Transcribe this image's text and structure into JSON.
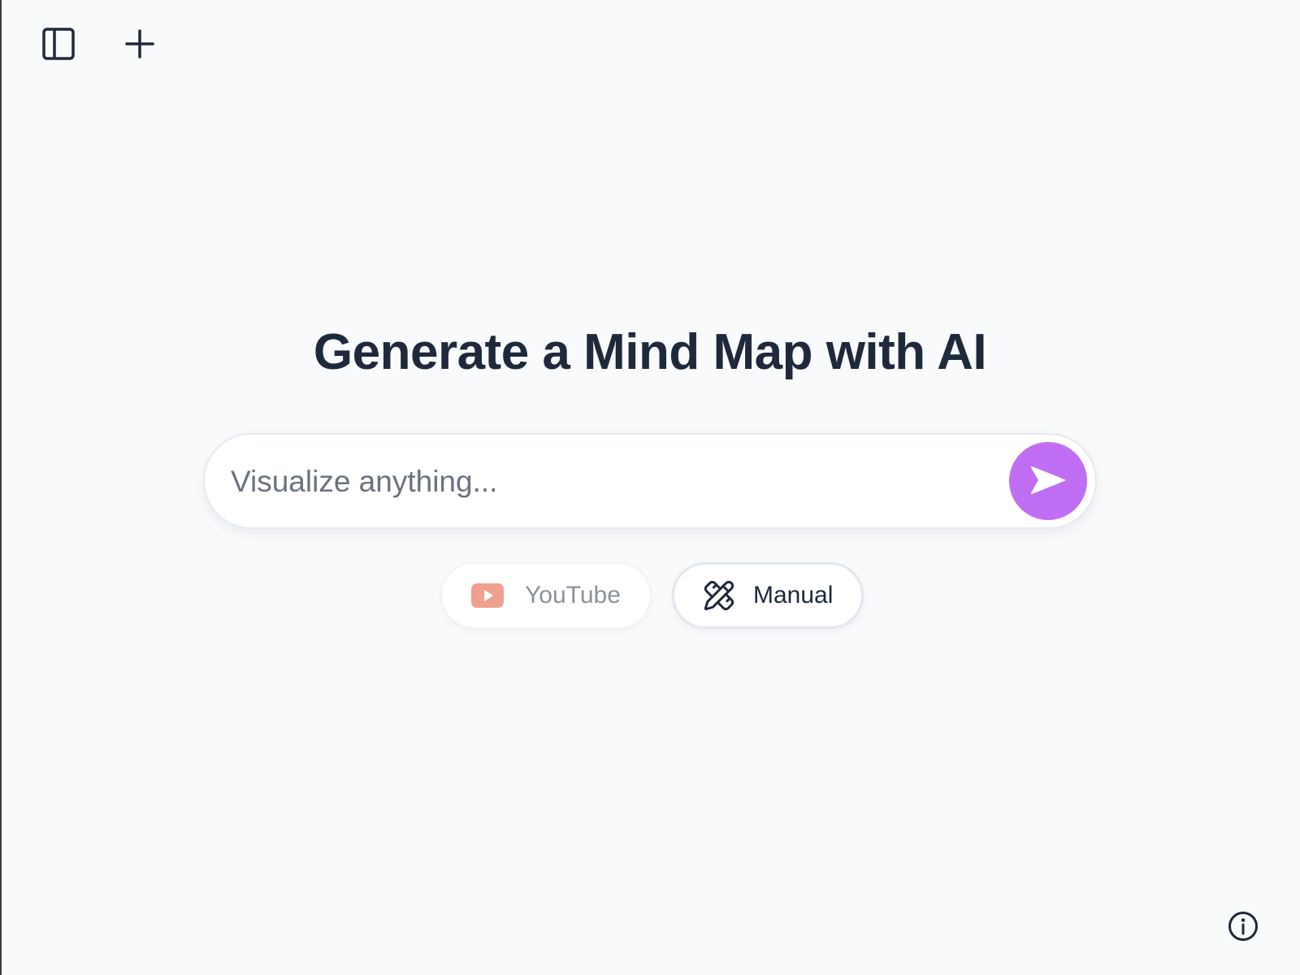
{
  "header": {
    "sidebar_toggle_icon": "sidebar-panel-icon",
    "new_icon": "plus-icon"
  },
  "main": {
    "title": "Generate a Mind Map with AI",
    "prompt": {
      "placeholder": "Visualize anything...",
      "value": "",
      "send_icon": "send-arrow-icon",
      "send_color": "#c06ff5"
    },
    "modes": [
      {
        "label": "YouTube",
        "icon": "youtube-icon",
        "color": "#f0a090",
        "state": "inactive"
      },
      {
        "label": "Manual",
        "icon": "pencil-ruler-icon",
        "state": "active"
      }
    ]
  },
  "footer": {
    "info_icon": "info-icon"
  },
  "colors": {
    "background": "#f8fafc",
    "text": "#1e293b",
    "accent": "#c06ff5"
  }
}
